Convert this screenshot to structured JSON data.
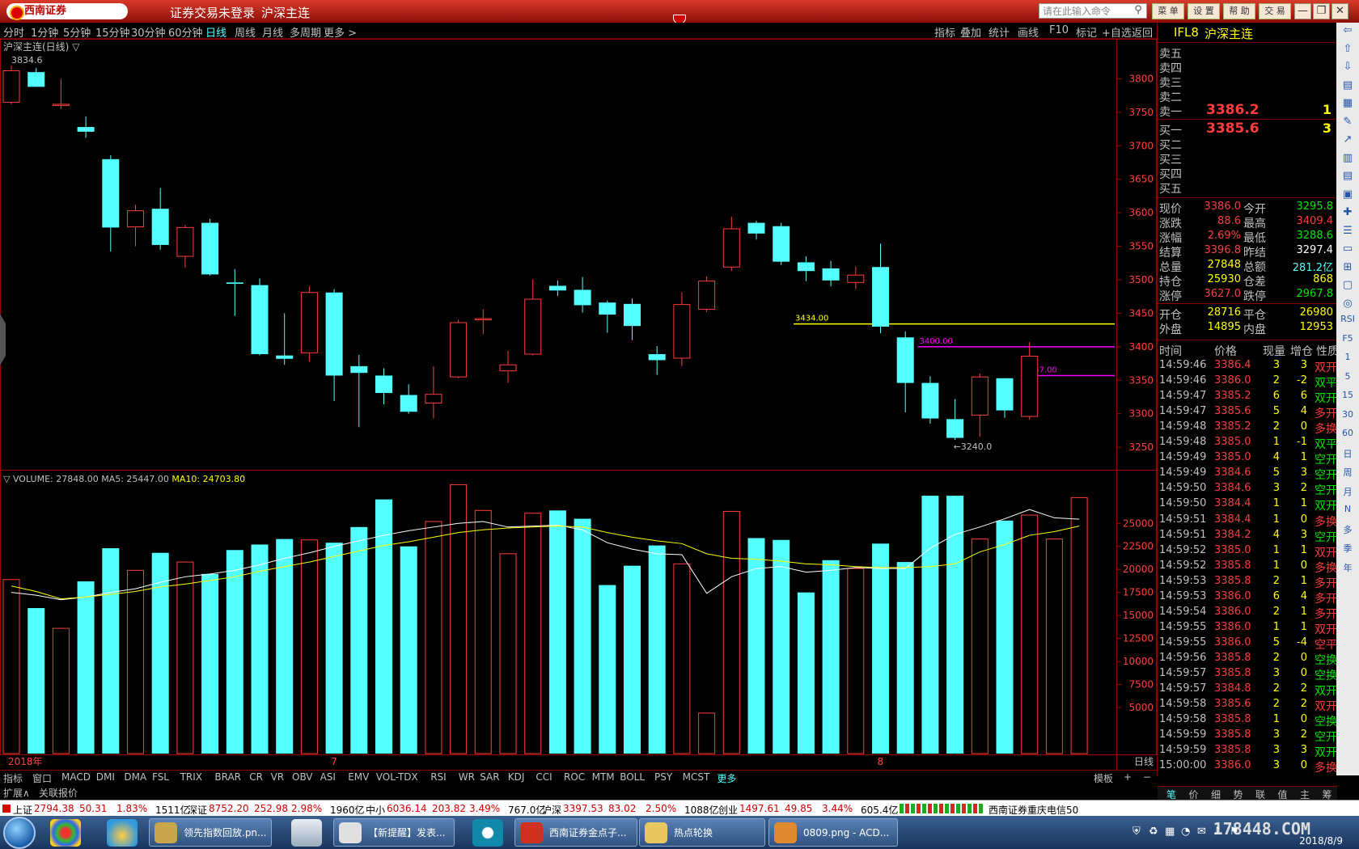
{
  "window": {
    "logo_text": "西南证券",
    "status": "证券交易未登录",
    "contract": "沪深主连",
    "command_placeholder": "请在此输入命令",
    "buttons": [
      "菜 单",
      "设 置",
      "帮 助",
      "交 易"
    ],
    "window_controls": [
      "—",
      "❐",
      "✕"
    ]
  },
  "periods": [
    {
      "label": "分时",
      "active": false
    },
    {
      "label": "1分钟",
      "active": false
    },
    {
      "label": "5分钟",
      "active": false
    },
    {
      "label": "15分钟",
      "active": false
    },
    {
      "label": "30分钟",
      "active": false
    },
    {
      "label": "60分钟",
      "active": false
    },
    {
      "label": "日线",
      "active": true
    },
    {
      "label": "周线",
      "active": false
    },
    {
      "label": "月线",
      "active": false
    },
    {
      "label": "多周期",
      "active": false
    },
    {
      "label": "更多 >",
      "active": false
    }
  ],
  "chart_tools": [
    "指标",
    "叠加",
    "统计",
    "画线",
    "F10",
    "标记",
    "+自选",
    "返回"
  ],
  "chart_data": [
    {
      "type": "candlestick",
      "title": "沪深主连(日线) ▽",
      "y_ticks": [
        3800,
        3750,
        3700,
        3650,
        3600,
        3550,
        3500,
        3450,
        3400,
        3350,
        3300,
        3250
      ],
      "ylim": [
        3220,
        3850
      ],
      "high_label": "3834.6",
      "low_label": "←3240.0",
      "x_labels": [
        {
          "label": "2018年",
          "index": 0
        },
        {
          "label": "7",
          "index": 13
        },
        {
          "label": "8",
          "index": 35
        }
      ],
      "x_label_bottom_right": "日线",
      "colors": {
        "up": "#ff3c3c",
        "down": "#54ffff"
      },
      "candles": [
        {
          "o": 3765,
          "h": 3820,
          "l": 3762,
          "c": 3812
        },
        {
          "o": 3810,
          "h": 3816,
          "l": 3790,
          "c": 3788
        },
        {
          "o": 3761,
          "h": 3800,
          "l": 3755,
          "c": 3762
        },
        {
          "o": 3728,
          "h": 3744,
          "l": 3712,
          "c": 3721
        },
        {
          "o": 3680,
          "h": 3686,
          "l": 3542,
          "c": 3578
        },
        {
          "o": 3579,
          "h": 3612,
          "l": 3550,
          "c": 3603
        },
        {
          "o": 3606,
          "h": 3637,
          "l": 3545,
          "c": 3552
        },
        {
          "o": 3535,
          "h": 3582,
          "l": 3518,
          "c": 3578
        },
        {
          "o": 3585,
          "h": 3591,
          "l": 3506,
          "c": 3508
        },
        {
          "o": 3496,
          "h": 3516,
          "l": 3446,
          "c": 3494
        },
        {
          "o": 3492,
          "h": 3502,
          "l": 3387,
          "c": 3389
        },
        {
          "o": 3387,
          "h": 3450,
          "l": 3373,
          "c": 3382
        },
        {
          "o": 3391,
          "h": 3490,
          "l": 3378,
          "c": 3481
        },
        {
          "o": 3481,
          "h": 3486,
          "l": 3319,
          "c": 3357
        },
        {
          "o": 3371,
          "h": 3388,
          "l": 3280,
          "c": 3361
        },
        {
          "o": 3357,
          "h": 3368,
          "l": 3314,
          "c": 3331
        },
        {
          "o": 3328,
          "h": 3344,
          "l": 3300,
          "c": 3303
        },
        {
          "o": 3316,
          "h": 3371,
          "l": 3293,
          "c": 3329
        },
        {
          "o": 3355,
          "h": 3440,
          "l": 3353,
          "c": 3436
        },
        {
          "o": 3441,
          "h": 3456,
          "l": 3419,
          "c": 3442
        },
        {
          "o": 3364,
          "h": 3394,
          "l": 3346,
          "c": 3373
        },
        {
          "o": 3389,
          "h": 3500,
          "l": 3387,
          "c": 3471
        },
        {
          "o": 3491,
          "h": 3499,
          "l": 3476,
          "c": 3484
        },
        {
          "o": 3485,
          "h": 3504,
          "l": 3451,
          "c": 3462
        },
        {
          "o": 3466,
          "h": 3469,
          "l": 3421,
          "c": 3448
        },
        {
          "o": 3464,
          "h": 3472,
          "l": 3410,
          "c": 3431
        },
        {
          "o": 3389,
          "h": 3401,
          "l": 3358,
          "c": 3380
        },
        {
          "o": 3383,
          "h": 3481,
          "l": 3371,
          "c": 3463
        },
        {
          "o": 3456,
          "h": 3505,
          "l": 3452,
          "c": 3498
        },
        {
          "o": 3519,
          "h": 3594,
          "l": 3513,
          "c": 3576
        },
        {
          "o": 3585,
          "h": 3588,
          "l": 3560,
          "c": 3569
        },
        {
          "o": 3580,
          "h": 3585,
          "l": 3522,
          "c": 3527
        },
        {
          "o": 3526,
          "h": 3535,
          "l": 3498,
          "c": 3513
        },
        {
          "o": 3517,
          "h": 3528,
          "l": 3490,
          "c": 3499
        },
        {
          "o": 3496,
          "h": 3520,
          "l": 3486,
          "c": 3507
        },
        {
          "o": 3519,
          "h": 3554,
          "l": 3420,
          "c": 3430
        },
        {
          "o": 3414,
          "h": 3423,
          "l": 3302,
          "c": 3346
        },
        {
          "o": 3346,
          "h": 3356,
          "l": 3285,
          "c": 3293
        },
        {
          "o": 3292,
          "h": 3322,
          "l": 3261,
          "c": 3264
        },
        {
          "o": 3298,
          "h": 3360,
          "l": 3266,
          "c": 3355
        },
        {
          "o": 3353,
          "h": 3353,
          "l": 3294,
          "c": 3305
        },
        {
          "o": 3296,
          "h": 3407,
          "l": 3291,
          "c": 3386
        }
      ],
      "hlines": [
        {
          "value": 3434.0,
          "label": "3434.00",
          "color": "#ffff00",
          "from": 31.5
        },
        {
          "value": 3400.0,
          "label": "3400.00",
          "color": "#ff00ff",
          "from": 36.5
        },
        {
          "value": 3357.0,
          "label": "3357.00",
          "color": "#ff00ff",
          "from": 40.7
        }
      ]
    },
    {
      "type": "bar",
      "title": "▽ VOLUME: 27848.00",
      "ma5_label": "MA5: 25447.00",
      "ma10_label": "MA10: 24703.80",
      "y_ticks": [
        25000,
        22500,
        20000,
        17500,
        15000,
        12500,
        10000,
        7500,
        5000
      ],
      "ylim": [
        0,
        29500
      ],
      "volumes": [
        18900,
        15800,
        13600,
        18700,
        22300,
        19900,
        21800,
        20800,
        19500,
        22100,
        22700,
        23300,
        23200,
        22900,
        24600,
        27600,
        22500,
        25200,
        29200,
        26400,
        21700,
        26100,
        26400,
        25500,
        18300,
        20400,
        22600,
        20600,
        4400,
        26300,
        23400,
        23200,
        17500,
        21000,
        20100,
        22800,
        20800,
        28000,
        28000,
        23300,
        25300,
        25900,
        23300,
        27800
      ],
      "ma5": [
        17500,
        17200,
        16700,
        17000,
        17500,
        17900,
        18600,
        19200,
        19500,
        19900,
        20500,
        21200,
        21800,
        22500,
        23100,
        23700,
        24200,
        24600,
        25000,
        25200,
        24600,
        24700,
        24800,
        24300,
        22900,
        22200,
        21700,
        21600,
        17400,
        19200,
        20100,
        20300,
        19700,
        19900,
        20200,
        20100,
        20100,
        22300,
        23800,
        24600,
        25500,
        26500,
        25600,
        25447
      ],
      "ma10": [
        18200,
        17600,
        16800,
        17000,
        17300,
        17600,
        18100,
        18400,
        18800,
        19200,
        19800,
        20300,
        20800,
        21400,
        22000,
        22600,
        23000,
        23500,
        24000,
        24300,
        24500,
        24600,
        24700,
        24600,
        24000,
        23500,
        23100,
        22800,
        21700,
        21200,
        21100,
        20900,
        20600,
        20500,
        20300,
        20200,
        20200,
        20300,
        20600,
        21900,
        22700,
        23700,
        24100,
        24703.8
      ],
      "colors": {
        "up": "#ff3c3c",
        "down": "#54ffff",
        "ma5": "#ffffff",
        "ma10": "#ffff00"
      }
    }
  ],
  "quote": {
    "header_code": "IFL8",
    "header_name": "沪深主连",
    "sell_labels": [
      "卖五",
      "卖四",
      "卖三",
      "卖二",
      "卖一"
    ],
    "sell1_price": "3386.2",
    "sell1_vol": "1",
    "buy_labels": [
      "买一",
      "买二",
      "买三",
      "买四",
      "买五"
    ],
    "buy1_price": "3385.6",
    "buy1_vol": "3",
    "stats": [
      {
        "k1": "现价",
        "v1": "3386.0",
        "c1": "#ff3c3c",
        "k2": "今开",
        "v2": "3295.8",
        "c2": "#00e600"
      },
      {
        "k1": "涨跌",
        "v1": "88.6",
        "c1": "#ff3c3c",
        "k2": "最高",
        "v2": "3409.4",
        "c2": "#ff3c3c"
      },
      {
        "k1": "涨幅",
        "v1": "2.69%",
        "c1": "#ff3c3c",
        "k2": "最低",
        "v2": "3288.6",
        "c2": "#00e600"
      },
      {
        "k1": "结算",
        "v1": "3396.8",
        "c1": "#ff3c3c",
        "k2": "昨结",
        "v2": "3297.4",
        "c2": "#ffffff"
      },
      {
        "k1": "总量",
        "v1": "27848",
        "c1": "#ffff00",
        "k2": "总额",
        "v2": "281.2亿",
        "c2": "#54ffff"
      },
      {
        "k1": "持仓",
        "v1": "25930",
        "c1": "#ffff00",
        "k2": "仓差",
        "v2": "868",
        "c2": "#ffff00"
      },
      {
        "k1": "涨停",
        "v1": "3627.0",
        "c1": "#ff3c3c",
        "k2": "跌停",
        "v2": "2967.8",
        "c2": "#00e600"
      }
    ],
    "stats2": [
      {
        "k1": "开仓",
        "v1": "28716",
        "k2": "平仓",
        "v2": "26980"
      },
      {
        "k1": "外盘",
        "v1": "14895",
        "k2": "内盘",
        "v2": "12953"
      }
    ],
    "tick_headers": [
      "时间",
      "价格",
      "现量",
      "增仓",
      "性质"
    ],
    "ticks": [
      {
        "t": "14:59:46",
        "p": "3386.4",
        "v": "3",
        "d": "3",
        "n": "双开",
        "nc": "#ff3c3c"
      },
      {
        "t": "14:59:46",
        "p": "3386.0",
        "v": "2",
        "d": "-2",
        "n": "双平",
        "nc": "#00e600"
      },
      {
        "t": "14:59:47",
        "p": "3385.2",
        "v": "6",
        "d": "6",
        "n": "双开",
        "nc": "#00e600"
      },
      {
        "t": "14:59:47",
        "p": "3385.6",
        "v": "5",
        "d": "4",
        "n": "多开",
        "nc": "#ff3c3c"
      },
      {
        "t": "14:59:48",
        "p": "3385.2",
        "v": "2",
        "d": "0",
        "n": "多换",
        "nc": "#ff3c3c"
      },
      {
        "t": "14:59:48",
        "p": "3385.0",
        "v": "1",
        "d": "-1",
        "n": "双平",
        "nc": "#00e600"
      },
      {
        "t": "14:59:49",
        "p": "3385.0",
        "v": "4",
        "d": "1",
        "n": "空开",
        "nc": "#00e600"
      },
      {
        "t": "14:59:49",
        "p": "3384.6",
        "v": "5",
        "d": "3",
        "n": "空开",
        "nc": "#00e600"
      },
      {
        "t": "14:59:50",
        "p": "3384.6",
        "v": "3",
        "d": "2",
        "n": "空开",
        "nc": "#00e600"
      },
      {
        "t": "14:59:50",
        "p": "3384.4",
        "v": "1",
        "d": "1",
        "n": "双开",
        "nc": "#00e600"
      },
      {
        "t": "14:59:51",
        "p": "3384.4",
        "v": "1",
        "d": "0",
        "n": "多换",
        "nc": "#ff3c3c"
      },
      {
        "t": "14:59:51",
        "p": "3384.2",
        "v": "4",
        "d": "3",
        "n": "空开",
        "nc": "#00e600"
      },
      {
        "t": "14:59:52",
        "p": "3385.0",
        "v": "1",
        "d": "1",
        "n": "双开",
        "nc": "#ff3c3c"
      },
      {
        "t": "14:59:52",
        "p": "3385.8",
        "v": "1",
        "d": "0",
        "n": "多换",
        "nc": "#ff3c3c"
      },
      {
        "t": "14:59:53",
        "p": "3385.8",
        "v": "2",
        "d": "1",
        "n": "多开",
        "nc": "#ff3c3c"
      },
      {
        "t": "14:59:53",
        "p": "3386.0",
        "v": "6",
        "d": "4",
        "n": "多开",
        "nc": "#ff3c3c"
      },
      {
        "t": "14:59:54",
        "p": "3386.0",
        "v": "2",
        "d": "1",
        "n": "多开",
        "nc": "#ff3c3c"
      },
      {
        "t": "14:59:55",
        "p": "3386.0",
        "v": "1",
        "d": "1",
        "n": "双开",
        "nc": "#ff3c3c"
      },
      {
        "t": "14:59:55",
        "p": "3386.0",
        "v": "5",
        "d": "-4",
        "n": "空平",
        "nc": "#ff3c3c"
      },
      {
        "t": "14:59:56",
        "p": "3385.8",
        "v": "2",
        "d": "0",
        "n": "空换",
        "nc": "#00e600"
      },
      {
        "t": "14:59:57",
        "p": "3385.8",
        "v": "3",
        "d": "0",
        "n": "空换",
        "nc": "#00e600"
      },
      {
        "t": "14:59:57",
        "p": "3384.8",
        "v": "2",
        "d": "2",
        "n": "双开",
        "nc": "#00e600"
      },
      {
        "t": "14:59:58",
        "p": "3385.6",
        "v": "2",
        "d": "2",
        "n": "双开",
        "nc": "#ff3c3c"
      },
      {
        "t": "14:59:58",
        "p": "3385.8",
        "v": "1",
        "d": "0",
        "n": "空换",
        "nc": "#00e600"
      },
      {
        "t": "14:59:59",
        "p": "3385.8",
        "v": "3",
        "d": "2",
        "n": "空开",
        "nc": "#00e600"
      },
      {
        "t": "14:59:59",
        "p": "3385.8",
        "v": "3",
        "d": "3",
        "n": "双开",
        "nc": "#00e600"
      },
      {
        "t": "15:00:00",
        "p": "3386.0",
        "v": "3",
        "d": "0",
        "n": "多换",
        "nc": "#ff3c3c"
      }
    ],
    "bottom_tabs": [
      "笔",
      "价",
      "细",
      "势",
      "联",
      "值",
      "主",
      "筹"
    ]
  },
  "side_strip": [
    "RSI",
    "F5",
    "1",
    "5",
    "15",
    "30",
    "60",
    "日",
    "周",
    "月",
    "N",
    "多",
    "季",
    "年"
  ],
  "indicators": [
    "指标",
    "窗口",
    "MACD",
    "DMI",
    "DMA",
    "FSL",
    "TRIX",
    "BRAR",
    "CR",
    "VR",
    "OBV",
    "ASI",
    "EMV",
    "VOL-TDX",
    "RSI",
    "WR",
    "SAR",
    "KDJ",
    "CCI",
    "ROC",
    "MTM",
    "BOLL",
    "PSY",
    "MCST",
    "更多"
  ],
  "indicator_right": [
    "模板",
    "+",
    "−"
  ],
  "indicator_row2": [
    "扩展∧",
    "关联报价"
  ],
  "ticker": [
    {
      "name": "上证",
      "value": "2794.38",
      "chg": "50.31",
      "pct": "1.83%",
      "amt": "1511亿"
    },
    {
      "name": "深证",
      "value": "8752.20",
      "chg": "252.98",
      "pct": "2.98%",
      "amt": "1960亿"
    },
    {
      "name": "中小",
      "value": "6036.14",
      "chg": "203.82",
      "pct": "3.49%",
      "amt": "767.0亿"
    },
    {
      "name": "沪深",
      "value": "3397.53",
      "chg": "83.02",
      "pct": "2.50%",
      "amt": "1088亿"
    },
    {
      "name": "创业",
      "value": "1497.61",
      "chg": "49.85",
      "pct": "3.44%",
      "amt": "605.4亿"
    }
  ],
  "ticker_right": "西南证券重庆电信50",
  "taskbar": {
    "tasks": [
      {
        "label": "领先指数回放.pn...",
        "color": "#c9a54d"
      },
      {
        "label": "【新提醒】发表...",
        "color": "#e0e0e0"
      },
      {
        "label": "西南证券金点子...",
        "color": "#d03020"
      },
      {
        "label": "热点轮换",
        "color": "#e9c860"
      },
      {
        "label": "0809.png - ACD...",
        "color": "#e08a30"
      }
    ],
    "watermark": "178448.COM",
    "date": "2018/8/9"
  }
}
